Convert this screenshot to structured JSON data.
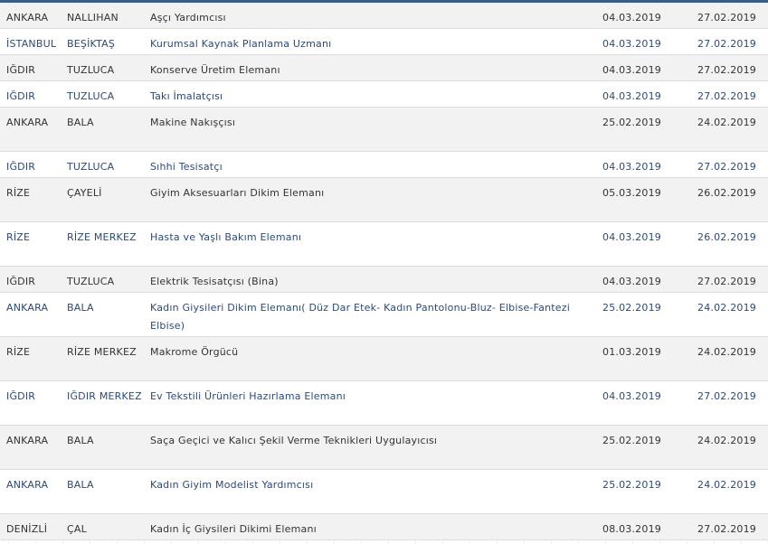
{
  "rows": [
    {
      "city": "ANKARA",
      "district": "NALLIHAN",
      "profession": "Aşçı Yardımcısı",
      "date1": "04.03.2019",
      "date2": "27.02.2019"
    },
    {
      "city": "İSTANBUL",
      "district": "BEŞİKTAŞ",
      "profession": "Kurumsal Kaynak Planlama Uzmanı",
      "date1": "04.03.2019",
      "date2": "27.02.2019"
    },
    {
      "city": "IĞDIR",
      "district": "TUZLUCA",
      "profession": "Konserve Üretim Elemanı",
      "date1": "04.03.2019",
      "date2": "27.02.2019"
    },
    {
      "city": "IĞDIR",
      "district": "TUZLUCA",
      "profession": "Takı İmalatçısı",
      "date1": "04.03.2019",
      "date2": "27.02.2019"
    },
    {
      "city": "ANKARA",
      "district": "BALA",
      "profession": "Makine Nakışçısı",
      "date1": "25.02.2019",
      "date2": "24.02.2019"
    },
    {
      "city": "IĞDIR",
      "district": "TUZLUCA",
      "profession": "Sıhhi Tesisatçı",
      "date1": "04.03.2019",
      "date2": "27.02.2019"
    },
    {
      "city": "RİZE",
      "district": "ÇAYELİ",
      "profession": "Giyim Aksesuarları Dikim Elemanı",
      "date1": "05.03.2019",
      "date2": "26.02.2019"
    },
    {
      "city": "RİZE",
      "district": "RİZE MERKEZ",
      "profession": "Hasta ve Yaşlı Bakım Elemanı",
      "date1": "04.03.2019",
      "date2": "26.02.2019"
    },
    {
      "city": "IĞDIR",
      "district": "TUZLUCA",
      "profession": "Elektrik Tesisatçısı (Bina)",
      "date1": "04.03.2019",
      "date2": "27.02.2019"
    },
    {
      "city": "ANKARA",
      "district": "BALA",
      "profession": "Kadın Giysileri Dikim Elemanı( Düz Dar Etek- Kadın Pantolonu-Bluz- Elbise-Fantezi Elbise)",
      "date1": "25.02.2019",
      "date2": "24.02.2019"
    },
    {
      "city": "RİZE",
      "district": "RİZE MERKEZ",
      "profession": "Makrome Örgücü",
      "date1": "01.03.2019",
      "date2": "24.02.2019"
    },
    {
      "city": "IĞDIR",
      "district": "IĞDIR MERKEZ",
      "profession": "Ev Tekstili Ürünleri Hazırlama Elemanı",
      "date1": "04.03.2019",
      "date2": "27.02.2019"
    },
    {
      "city": "ANKARA",
      "district": "BALA",
      "profession": "Saça Geçici ve Kalıcı Şekil Verme Teknikleri Uygulayıcısı",
      "date1": "25.02.2019",
      "date2": "24.02.2019"
    },
    {
      "city": "ANKARA",
      "district": "BALA",
      "profession": "Kadın Giyim Modelist Yardımcısı",
      "date1": "25.02.2019",
      "date2": "24.02.2019"
    },
    {
      "city": "DENİZLİ",
      "district": "ÇAL",
      "profession": "Kadın İç Giysileri Dikimi Elemanı",
      "date1": "08.03.2019",
      "date2": "27.02.2019"
    }
  ]
}
